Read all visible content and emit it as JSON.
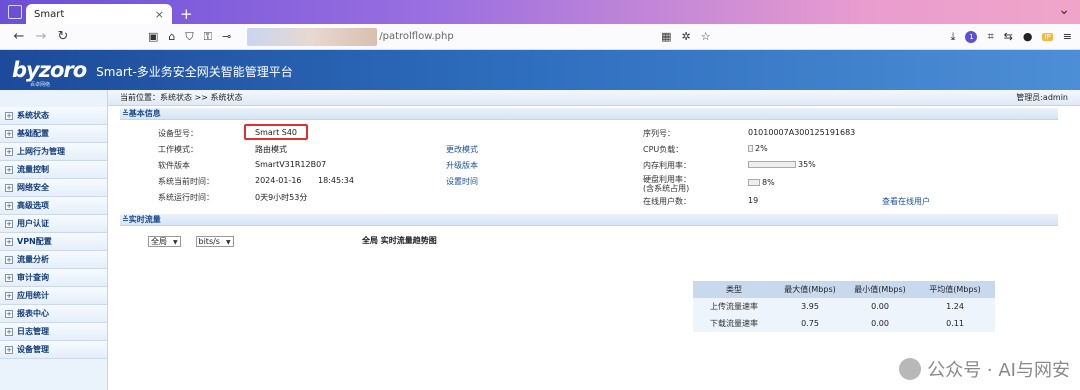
{
  "browser": {
    "tab_title": "Smart",
    "tab_close": "×",
    "new_tab": "+",
    "window_control": "⌄",
    "url": "/patrolflow.php"
  },
  "app": {
    "logo": "byzoro",
    "logo_sub": "百卓网络",
    "title": "Smart-多业务安全网关智能管理平台"
  },
  "breadcrumb": {
    "label": "当前位置：",
    "path": "系统状态 >> 系统状态",
    "admin": "管理员:admin"
  },
  "sidebar": {
    "items": [
      {
        "label": "系统状态"
      },
      {
        "label": "基础配置"
      },
      {
        "label": "上网行为管理"
      },
      {
        "label": "流量控制"
      },
      {
        "label": "网络安全"
      },
      {
        "label": "高级选项"
      },
      {
        "label": "用户认证"
      },
      {
        "label": "VPN配置"
      },
      {
        "label": "流量分析"
      },
      {
        "label": "审计查询"
      },
      {
        "label": "应用统计"
      },
      {
        "label": "报表中心"
      },
      {
        "label": "日志管理"
      },
      {
        "label": "设备管理"
      }
    ]
  },
  "basic": {
    "section_title": "基本信息",
    "device_model_label": "设备型号：",
    "device_model": "Smart S40",
    "work_mode_label": "工作模式：",
    "work_mode": "路由模式",
    "change_mode_link": "更改模式",
    "software_label": "软件版本",
    "software": "SmartV31R12B07",
    "upgrade_link": "升级版本",
    "sys_time_label": "系统当前时间：",
    "sys_date": "2024-01-16",
    "sys_clock": "18:45:34",
    "set_time_link": "设置时间",
    "uptime_label": "系统运行时间：",
    "uptime": "0天9小时53分",
    "serial_label": "序列号：",
    "serial": "01010007A300125191683",
    "cpu_label": "CPU负载：",
    "cpu": "2%",
    "cpu_pct": 2,
    "mem_label": "内存利用率：",
    "mem": "35%",
    "mem_pct": 35,
    "disk_label_1": "硬盘利用率：",
    "disk_label_2": "(含系统占用)",
    "disk": "8%",
    "disk_pct": 8,
    "online_label": "在线用户数：",
    "online": "19",
    "online_link": "查看在线用户",
    "colors": {
      "cpu": "#e04040",
      "mem": "#3cbf3c",
      "disk": "#e8b040"
    }
  },
  "realtime": {
    "section_title": "实时流量",
    "scope_select": "全局",
    "unit_select": "bits/s",
    "chart_title": "全局 实时流量趋势图"
  },
  "stats": {
    "headers": [
      "类型",
      "最大值(Mbps)",
      "最小值(Mbps)",
      "平均值(Mbps)"
    ],
    "rows": [
      [
        "上传流量速率",
        "3.95",
        "0.00",
        "1.24"
      ],
      [
        "下载流量速率",
        "0.75",
        "0.00",
        "0.11"
      ]
    ]
  },
  "watermark": {
    "text": "公众号 · AI与网安"
  }
}
